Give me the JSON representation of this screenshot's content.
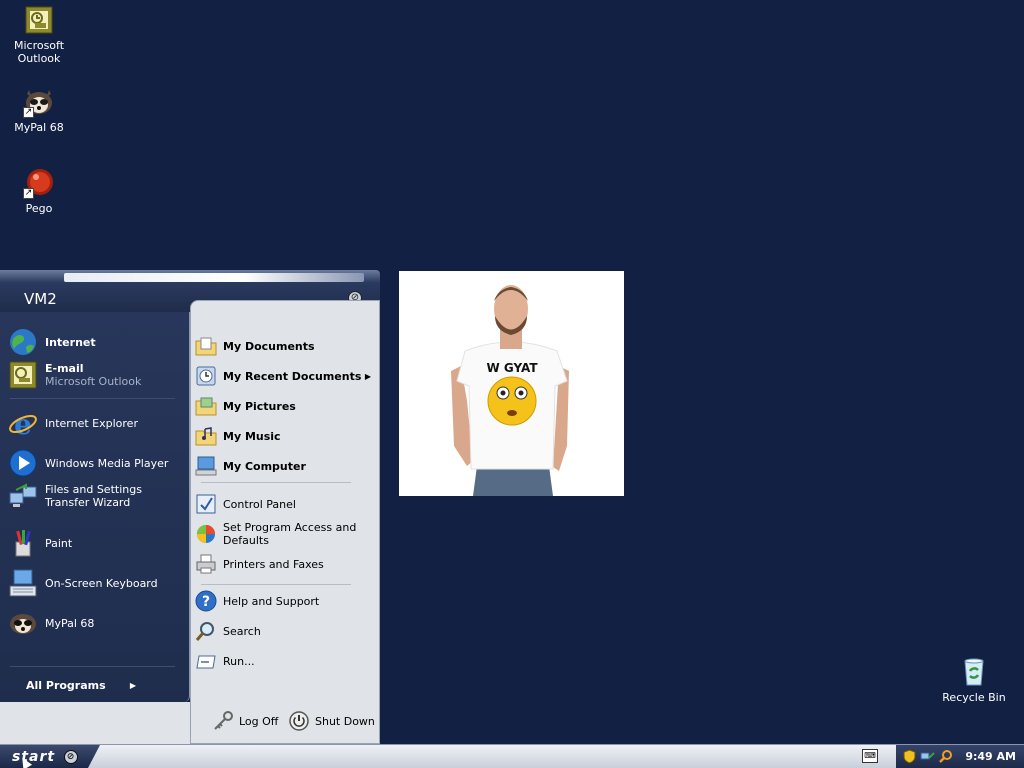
{
  "desktop": {
    "icons": [
      {
        "label": "Microsoft Outlook",
        "icon": "outlook-icon"
      },
      {
        "label": "MyPal 68",
        "icon": "mypal-icon"
      },
      {
        "label": "Pego",
        "icon": "pego-icon"
      },
      {
        "label": "Recycle Bin",
        "icon": "recycle-bin-icon"
      }
    ]
  },
  "image_window": {
    "shirt_text": "W GYAT"
  },
  "start_menu": {
    "user": "VM2",
    "pinned": [
      {
        "label": "Internet",
        "icon": "globe-icon"
      },
      {
        "label": "E-mail",
        "sublabel": "Microsoft Outlook",
        "icon": "outlook-icon"
      }
    ],
    "recent": [
      {
        "label": "Internet Explorer",
        "icon": "ie-icon"
      },
      {
        "label": "Windows Media Player",
        "icon": "media-player-icon"
      },
      {
        "label": "Files and Settings Transfer Wizard",
        "icon": "transfer-wizard-icon"
      },
      {
        "label": "Paint",
        "icon": "paint-icon"
      },
      {
        "label": "On-Screen Keyboard",
        "icon": "keyboard-icon"
      },
      {
        "label": "MyPal 68",
        "icon": "mypal-icon"
      }
    ],
    "all_programs": "All Programs",
    "places": [
      {
        "label": "My Documents",
        "icon": "folder-documents-icon"
      },
      {
        "label": "My Recent Documents",
        "icon": "recent-documents-icon"
      },
      {
        "label": "My Pictures",
        "icon": "folder-pictures-icon"
      },
      {
        "label": "My Music",
        "icon": "folder-music-icon"
      },
      {
        "label": "My Computer",
        "icon": "computer-icon"
      }
    ],
    "settings": [
      {
        "label": "Control Panel",
        "icon": "control-panel-icon"
      },
      {
        "label": "Set Program Access and Defaults",
        "icon": "program-access-icon"
      },
      {
        "label": "Printers and Faxes",
        "icon": "printer-icon"
      }
    ],
    "help": [
      {
        "label": "Help and Support",
        "icon": "help-icon"
      },
      {
        "label": "Search",
        "icon": "search-icon"
      },
      {
        "label": "Run...",
        "icon": "run-icon"
      }
    ],
    "log_off": "Log Off",
    "shut_down": "Shut Down"
  },
  "taskbar": {
    "start_label": "start",
    "clock": "9:49 AM"
  },
  "colors": {
    "desktop_bg": "#122143",
    "menu_left_bg": "#27365a",
    "menu_right_bg": "#e0e3e8"
  }
}
